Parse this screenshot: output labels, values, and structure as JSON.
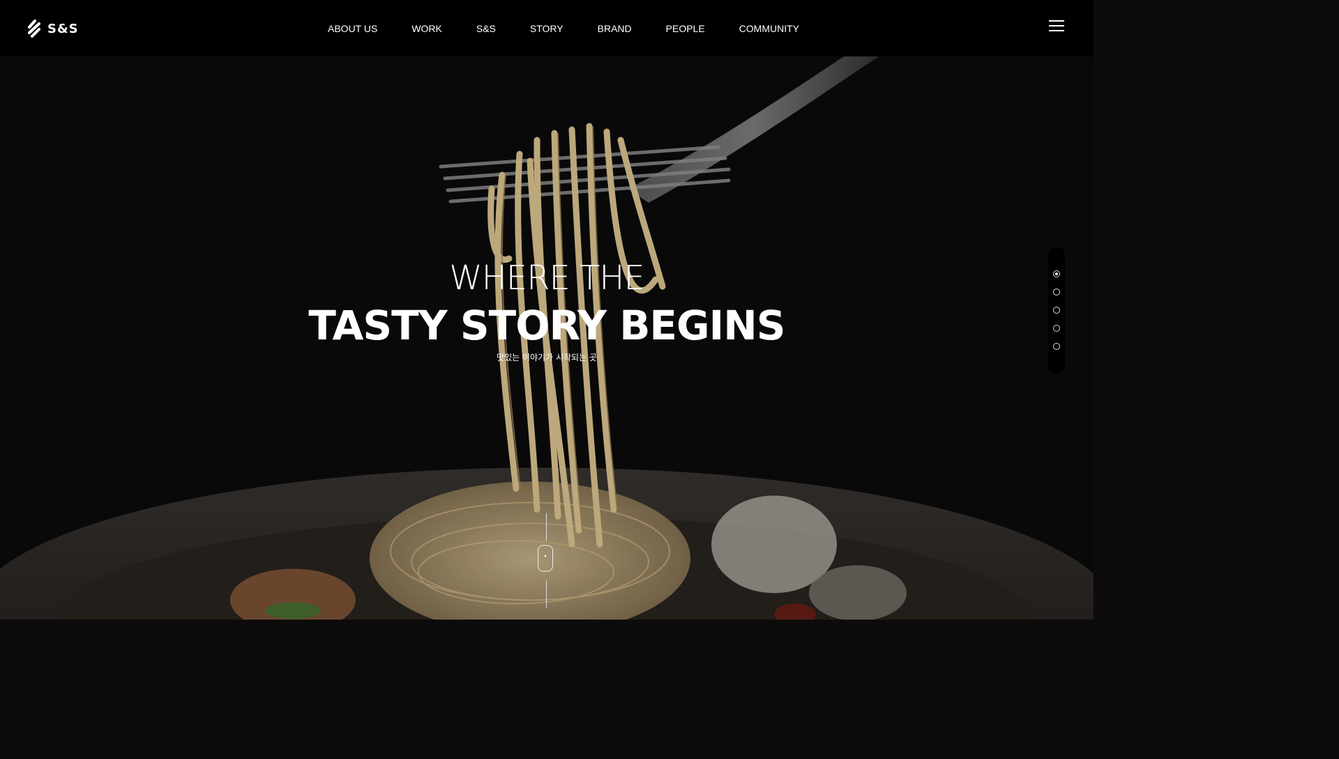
{
  "header": {
    "logo_text": "S&S",
    "nav": [
      "ABOUT US",
      "WORK",
      "S&S",
      "STORY",
      "BRAND",
      "PEOPLE",
      "COMMUNITY"
    ],
    "menu_icon": "hamburger-icon"
  },
  "hero": {
    "line1": "WHERE THE",
    "line2": "TASTY STORY BEGINS",
    "subtitle": "맛있는 이야기가 시작되는 곳",
    "background": "spaghetti-on-fork-photo"
  },
  "pager": {
    "count": 5,
    "active_index": 0
  },
  "scroll_indicator": "mouse-scroll-icon",
  "colors": {
    "header_bg": "#000000",
    "hero_bg": "#0d0b0b",
    "text": "#ffffff"
  }
}
